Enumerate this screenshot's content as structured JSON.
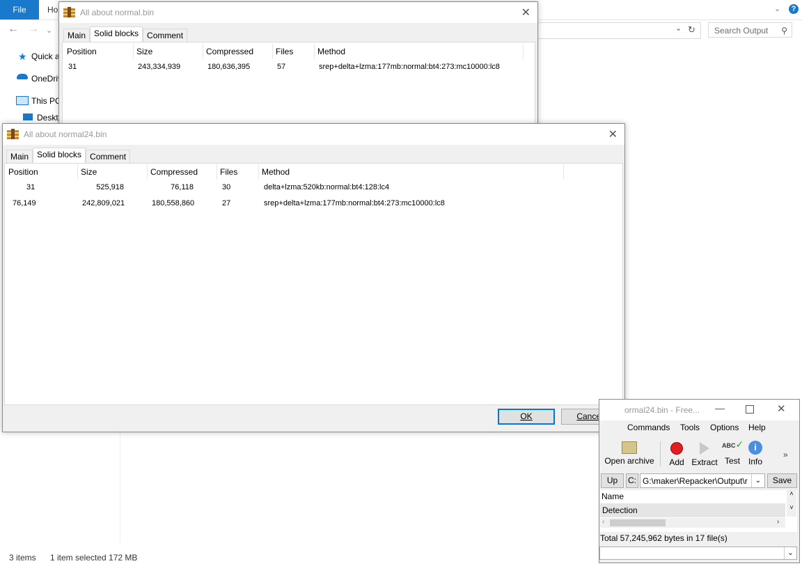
{
  "explorer": {
    "file_tab": "File",
    "home_tab": "Ho",
    "search_placeholder": "Search Output",
    "nav_items": [
      "Quick a",
      "OneDriv",
      "This PC",
      "Deskt"
    ],
    "status": {
      "items": "3 items",
      "selected": "1 item selected  172 MB"
    }
  },
  "dialog1": {
    "title": "All about normal.bin",
    "tabs": [
      "Main",
      "Solid blocks",
      "Comment"
    ],
    "active_tab": 1,
    "columns": [
      "Position",
      "Size",
      "Compressed",
      "Files",
      "Method"
    ],
    "rows": [
      [
        "31",
        "243,334,939",
        "180,636,395",
        "57",
        "srep+delta+lzma:177mb:normal:bt4:273:mc10000:lc8"
      ]
    ]
  },
  "dialog2": {
    "title": "All about normal24.bin",
    "tabs": [
      "Main",
      "Solid blocks",
      "Comment"
    ],
    "active_tab": 1,
    "columns": [
      "Position",
      "Size",
      "Compressed",
      "Files",
      "Method"
    ],
    "rows": [
      [
        "31",
        "525,918",
        "76,118",
        "30",
        "delta+lzma:520kb:normal:bt4:128:lc4"
      ],
      [
        "76,149",
        "242,809,021",
        "180,558,860",
        "27",
        "srep+delta+lzma:177mb:normal:bt4:273:mc10000:lc8"
      ]
    ],
    "ok_label": "OK",
    "cancel_label": "Cancel"
  },
  "freearc": {
    "title": "ormal24.bin - Free...",
    "menu": [
      "Commands",
      "Tools",
      "Options",
      "Help"
    ],
    "toolbar": [
      "Open archive",
      "Add",
      "Extract",
      "Test",
      "Info"
    ],
    "up_label": "Up",
    "drive_label": "C:",
    "path_value": "G:\\maker\\Repacker\\Output\\r",
    "save_label": "Save",
    "list_header": "Name",
    "list_item": "Detection",
    "total": "Total 57,245,962 bytes in 17 file(s)"
  }
}
